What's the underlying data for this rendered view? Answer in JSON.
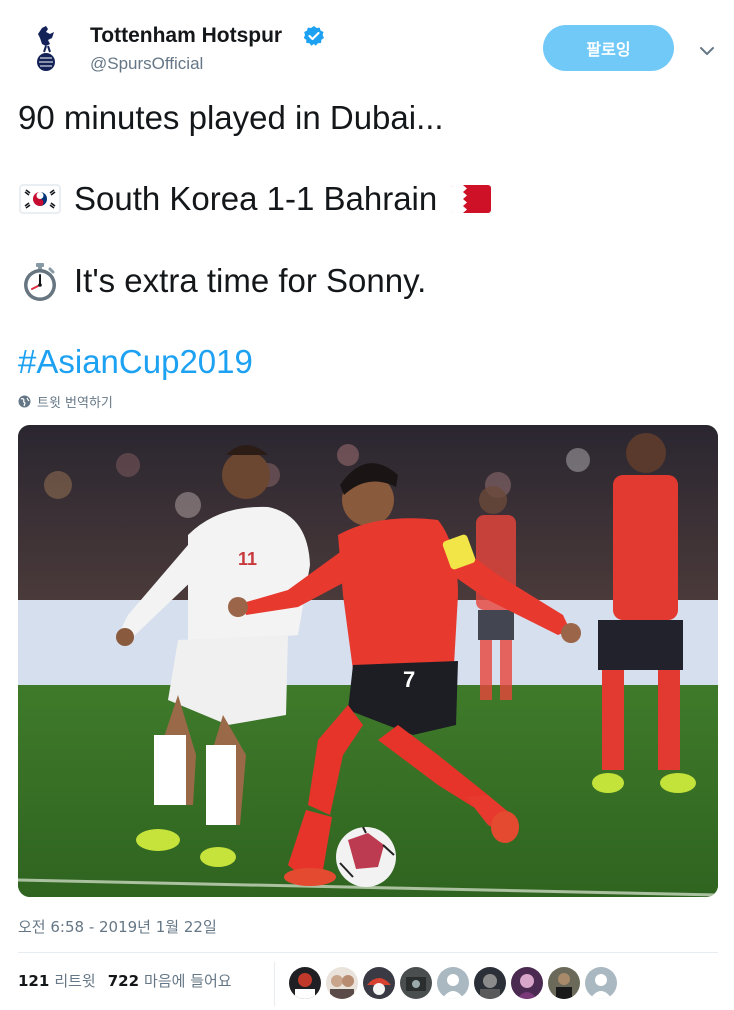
{
  "account": {
    "name": "Tottenham Hotspur",
    "handle": "@SpursOfficial",
    "verified": true,
    "logo_icon": "spurs-cockerel-logo"
  },
  "follow_button": {
    "label": "팔로잉",
    "color": "#71c9f8"
  },
  "menu_icon": "chevron-down-icon",
  "tweet": {
    "line1": "90 minutes played in Dubai...",
    "line2_emoji_left": "south-korea-flag",
    "line2_text": "South Korea 1-1 Bahrain",
    "line2_emoji_right": "bahrain-flag",
    "line3_emoji": "stopwatch",
    "line3_text": "It's extra time for Sonny.",
    "hashtag": "#AsianCup2019",
    "hashtag_color": "#1da1f2"
  },
  "translate": {
    "label": "트윗 번역하기",
    "icon": "globe-icon"
  },
  "media": {
    "alt": ""
  },
  "timestamp": "오전 6:58 - 2019년 1월 22일",
  "stats": {
    "retweets_count": "121",
    "retweets_label": "리트윗",
    "likes_count": "722",
    "likes_label": "마음에 들어요"
  },
  "likers": [
    {
      "avatar": "avatar-1"
    },
    {
      "avatar": "avatar-2"
    },
    {
      "avatar": "avatar-3"
    },
    {
      "avatar": "avatar-4"
    },
    {
      "avatar": "avatar-default"
    },
    {
      "avatar": "avatar-6"
    },
    {
      "avatar": "avatar-7"
    },
    {
      "avatar": "avatar-8"
    },
    {
      "avatar": "avatar-default"
    }
  ]
}
